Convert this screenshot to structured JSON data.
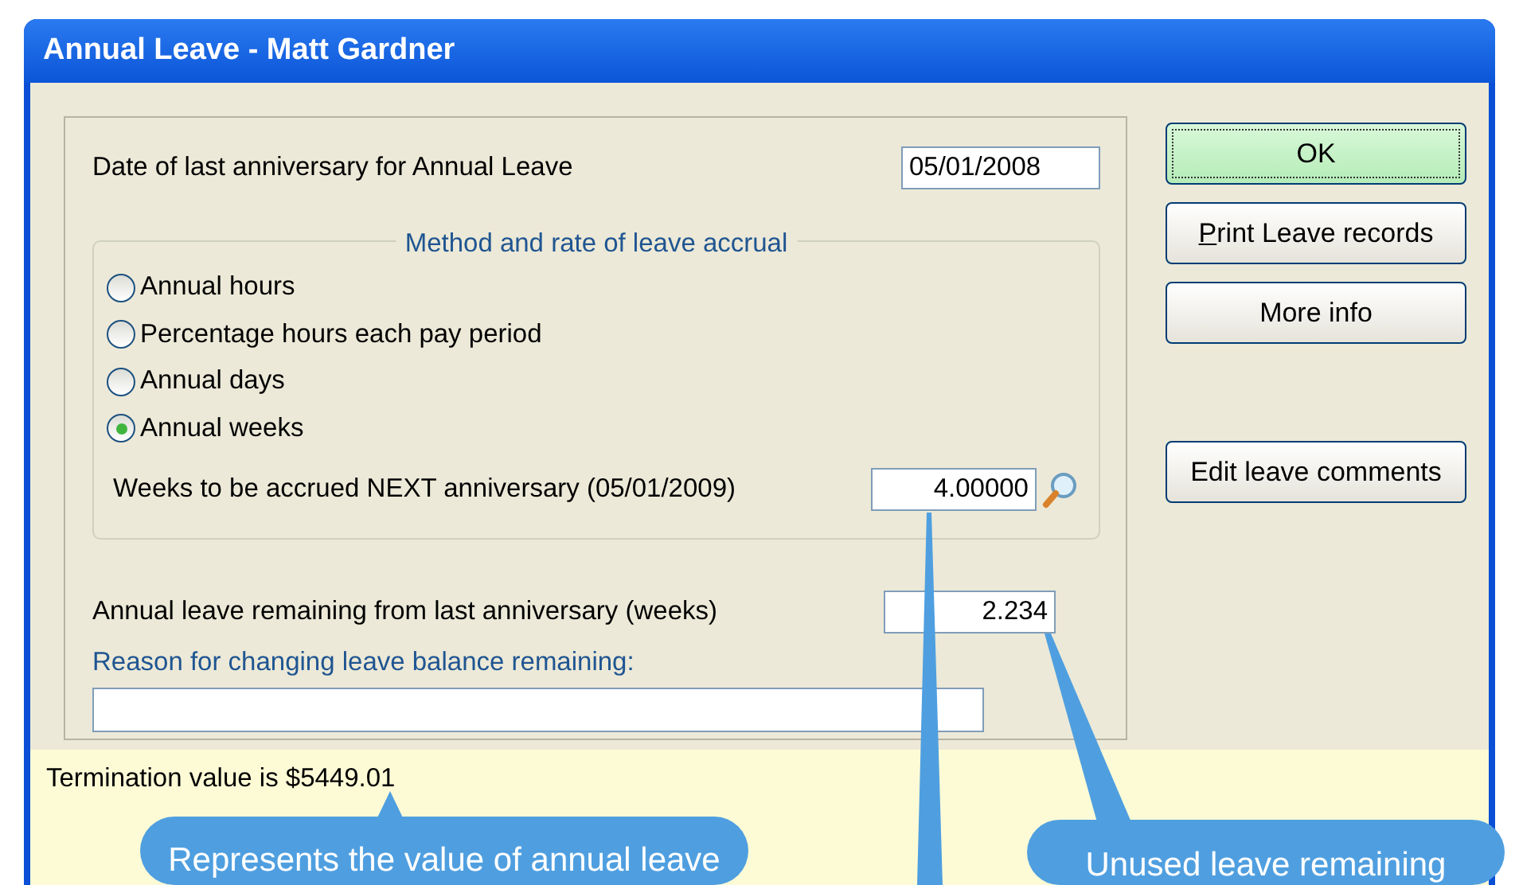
{
  "window": {
    "title": "Annual Leave - Matt Gardner"
  },
  "anniversary": {
    "label": "Date of last anniversary for Annual Leave",
    "value": "05/01/2008"
  },
  "accrual": {
    "legend": "Method and rate of leave accrual",
    "options": [
      {
        "label": "Annual hours",
        "selected": false
      },
      {
        "label": "Percentage hours each pay period",
        "selected": false
      },
      {
        "label": "Annual days",
        "selected": false
      },
      {
        "label": "Annual weeks",
        "selected": true
      }
    ],
    "next": {
      "label": "Weeks to be accrued NEXT anniversary (05/01/2009)",
      "value": "4.00000"
    }
  },
  "remaining": {
    "label": "Annual leave remaining from last anniversary (weeks)",
    "value": "2.234"
  },
  "reason": {
    "label": "Reason for changing leave balance remaining:"
  },
  "buttons": [
    {
      "label": "OK",
      "default": true,
      "underline_first": false
    },
    {
      "label": "Print Leave records",
      "default": false,
      "underline_first": true
    },
    {
      "label": "More info",
      "default": false,
      "underline_first": false
    }
  ],
  "comments_button": {
    "label": "Edit leave comments"
  },
  "status": {
    "text": "Termination value is $5449.01"
  },
  "callouts": [
    {
      "text": "Represents the value of annual leave"
    },
    {
      "text": "Unused leave remaining"
    }
  ]
}
